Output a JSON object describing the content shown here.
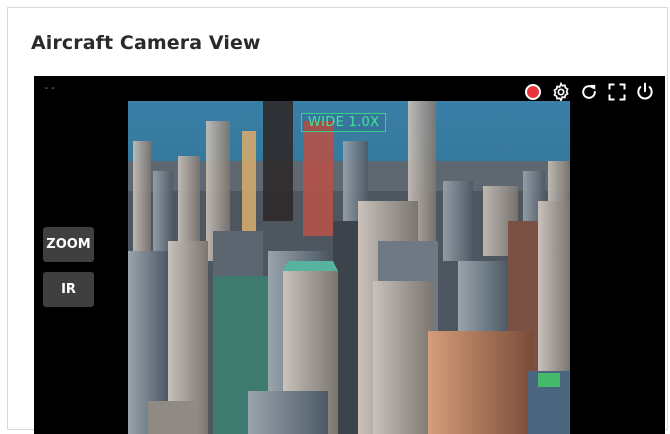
{
  "card": {
    "title": "Aircraft Camera View"
  },
  "viewer": {
    "status_text": "--",
    "overlay_label": "WIDE 1.0X",
    "side_buttons": {
      "zoom": "ZOOM",
      "ir": "IR"
    },
    "toolbar_icons": [
      "record-icon",
      "gear-icon",
      "refresh-icon",
      "fullscreen-icon",
      "power-icon"
    ]
  },
  "colors": {
    "record": "#e8343b",
    "overlay": "#33d18a",
    "button_bg": "#3f3f3f"
  }
}
